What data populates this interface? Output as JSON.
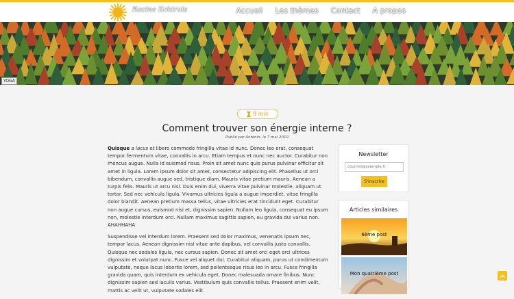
{
  "header": {
    "brand": "Racine Ecktrois",
    "nav": [
      "Accueil",
      "Les thèmes",
      "Contact",
      "A propos"
    ]
  },
  "hero": {
    "tag": "YOGA"
  },
  "article": {
    "reading_time": "9 min",
    "title": "Comment trouver son énergie interne ?",
    "meta": "Publié par Antonin, le 7 mai 2019",
    "lead_bold": "Quisque",
    "lead_italic": "a lacus",
    "p1_rest": "et libero commodo fringilla vitae id nunc. Donec leo erat, consequat tempor fermentum vitae, convallis in arcu. Etiam tempus et nunc nec auctor. Curabitur non rhoncus augue. Nulla id euismod risus. Proin sit amet nunc quis purus pulvinar efficitur sit amet in ligula. Lorem ipsum dolor sit amet, consectetur adipiscing elit. Phasellus ut orci bibendum, convallis augue sed, tristique diam. Mauris vitae pretium mauris. Aenean a turpis felis. Mauris ut arcu nisl. Duis enim dui, viverra vitae pulvinar molestie, aliquam ut tortor. Sed nec vehicula ligula. Vivamus ultricies ligula a augue imperdiet, vitae fringilla dolor blandit. Aenean pretium massa tellus, vitae ultricies erat tincidunt eget. Curabitur non augue cursus, euismod nisi et, dignissim sapien. Nullam leo ligula, consequat eu ipsum non, molestie interdum orci. Nullam maximus sagittis sapien, eu gravida dui varius non. AHAHHAHA",
    "p2": "Suspendisse vel interdum lorem. Praesent sed dolor maximus, venenatis ipsum nec, tempor lacus. Aenean dignissim nisl vitae ante dapibus, vel convallis justo convallis. Quisque nec sodales ligula, nec cursus sapien. Donec sit amet orci eget orci ultrices dignissim et volutpat nunc. Fusce vel aliquet dui. Curabitur aliquam, purus ut condimentum vulputate, neque lacus lobortis lorem, sed pellentesque risus leo in arcu. Fusce fringilla gravida quam, quis interdum ex vehicula eget. Donec malesuada ornare finibus. Nunc dignissim sapien sed iaculis varius. Vestibulum quis convallis tellus. Praesent enim velit, mattis ac velit ut, vulputate sodales elit."
  },
  "newsletter": {
    "title": "Newsletter",
    "placeholder": "courriel@exemple.fr",
    "button": "S'inscrire"
  },
  "related": {
    "title": "Articles similaires",
    "items": [
      "6ème post",
      "Mon quatrième post"
    ]
  },
  "colors": {
    "accent": "#f3c020",
    "text": "#333333",
    "background": "#f4f4f4"
  },
  "icons": [
    "sun-logo-icon",
    "hourglass-icon",
    "chevron-up-icon"
  ]
}
